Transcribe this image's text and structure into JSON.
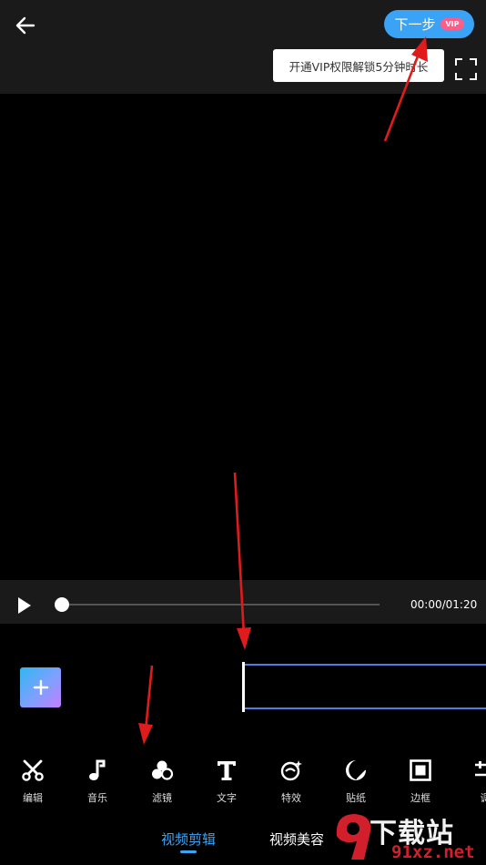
{
  "header": {
    "back_icon": "arrow-left-icon",
    "next_label": "下一步",
    "vip_badge": "VIP",
    "tooltip": "开通VIP权限解锁5分钟时长",
    "fullscreen_icon": "fullscreen-icon"
  },
  "player": {
    "time": "00:00/01:20",
    "progress": 0
  },
  "timeline": {
    "add_icon": "plus-icon"
  },
  "tools": [
    {
      "label": "编辑",
      "icon": "scissors-icon"
    },
    {
      "label": "音乐",
      "icon": "music-note-icon"
    },
    {
      "label": "滤镜",
      "icon": "filter-icon"
    },
    {
      "label": "文字",
      "icon": "text-icon"
    },
    {
      "label": "特效",
      "icon": "effects-icon"
    },
    {
      "label": "贴纸",
      "icon": "sticker-icon"
    },
    {
      "label": "边框",
      "icon": "frame-icon"
    },
    {
      "label": "调",
      "icon": "adjust-icon"
    }
  ],
  "tabs": [
    {
      "label": "视频剪辑",
      "active": true
    },
    {
      "label": "视频美容",
      "active": false
    }
  ],
  "watermark": {
    "line1": "下载站",
    "line2": "91xz.net"
  },
  "colors": {
    "accent": "#3aa3f5",
    "vip": "#ff5c8a",
    "annotation": "#e01b1b"
  }
}
